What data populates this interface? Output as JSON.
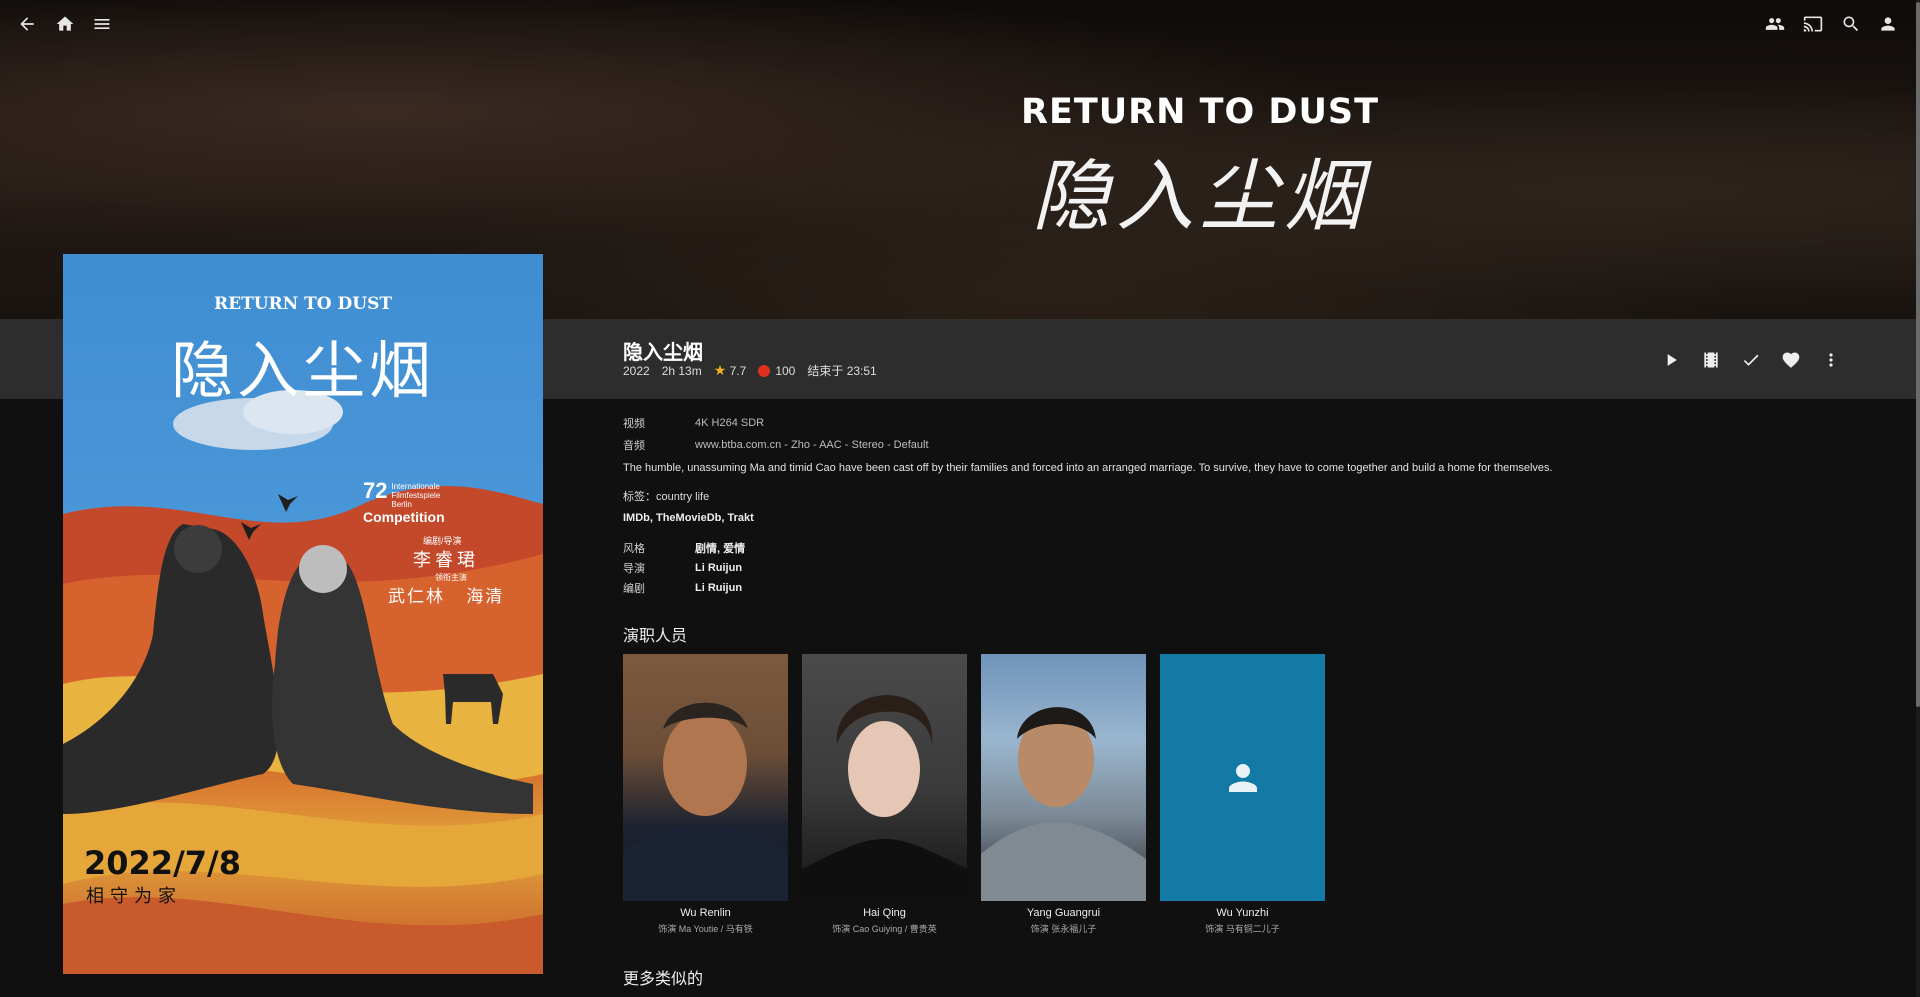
{
  "topbar": {
    "left_icons": [
      "back-arrow-icon",
      "home-icon",
      "menu-icon"
    ],
    "right_icons": [
      "sync-play-icon",
      "cast-icon",
      "search-icon",
      "user-icon"
    ]
  },
  "backdrop": {
    "logo_en": "RETURN TO DUST",
    "logo_cn": "隐入尘烟"
  },
  "item": {
    "title": "隐入尘烟",
    "year": "2022",
    "runtime": "2h 13m",
    "community_rating": "7.7",
    "critic_rating": "100",
    "ends_at": "结束于 23:51"
  },
  "actions": [
    "play-icon",
    "trailer-icon",
    "played-check-icon",
    "favorite-heart-icon",
    "more-vert-icon"
  ],
  "poster": {
    "title_en": "RETURN TO DUST",
    "title_cn": "隐入尘烟",
    "award_number": "72",
    "award_text": "Competition",
    "festival": "Internationale Filmfestspiele Berlin",
    "director_label": "编剧/导演",
    "director": "李睿珺",
    "cast_label": "领衔主演",
    "cast": "武仁林 海清",
    "release_date": "2022/7/8",
    "tagline": "相守为家"
  },
  "media": {
    "video_label": "视频",
    "video_value": "4K H264 SDR",
    "audio_label": "音频",
    "audio_value": "www.btba.com.cn - Zho - AAC - Stereo - Default"
  },
  "overview": "The humble, unassuming Ma and timid Cao have been cast off by their families and forced into an arranged marriage. To survive, they have to come together and build a home for themselves.",
  "tags": "标签：country life",
  "external_links": "IMDb, TheMovieDb, Trakt",
  "credits": {
    "genre_label": "风格",
    "genre_value": "剧情, 爱情",
    "director_label": "导演",
    "director_value": "Li Ruijun",
    "writer_label": "编剧",
    "writer_value": "Li Ruijun"
  },
  "cast_section": {
    "title": "演职人员",
    "people": [
      {
        "name": "Wu Renlin",
        "role": "饰演 Ma Youtie / 马有铁"
      },
      {
        "name": "Hai Qing",
        "role": "饰演 Cao Guiying / 曹贵英"
      },
      {
        "name": "Yang Guangrui",
        "role": "饰演 张永福儿子"
      },
      {
        "name": "Wu Yunzhi",
        "role": "饰演 马有铜二儿子"
      }
    ]
  },
  "similar_section": {
    "title": "更多类似的"
  },
  "colors": {
    "background": "#101010",
    "band": "#303030",
    "star": "#f2b01e",
    "tomato": "#e0301e",
    "placeholder_card": "#137aa5"
  }
}
